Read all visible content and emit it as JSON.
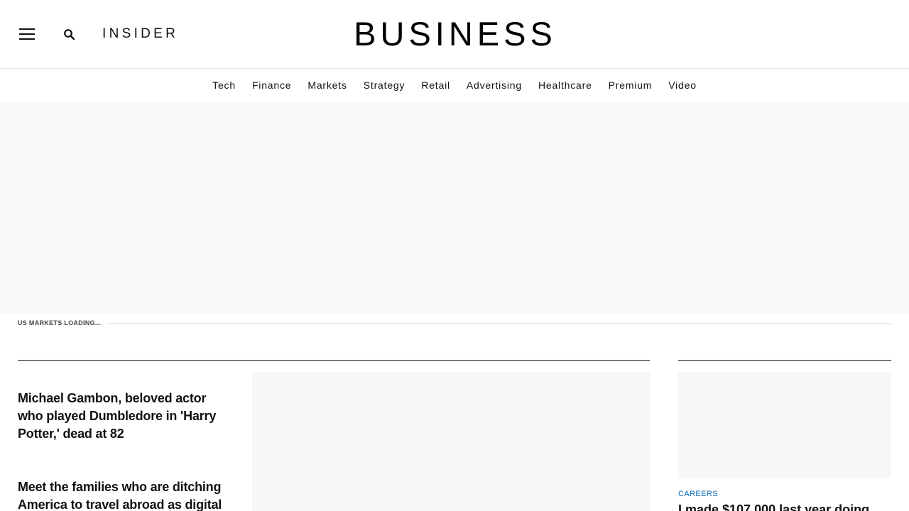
{
  "header": {
    "menu_icon": "hamburger-menu-icon",
    "search_icon": "search-icon",
    "small_logo": "INSIDER",
    "main_logo": "BUSINESS"
  },
  "nav": {
    "items": [
      "Tech",
      "Finance",
      "Markets",
      "Strategy",
      "Retail",
      "Advertising",
      "Healthcare",
      "Premium",
      "Video"
    ]
  },
  "markets": {
    "label": "US MARKETS LOADING..."
  },
  "stories": [
    {
      "headline": "Michael Gambon, beloved actor who played Dumbledore in 'Harry Potter,' dead at 82"
    },
    {
      "headline": "Meet the families who are ditching America to travel abroad as digital"
    }
  ],
  "sidebar_story": {
    "category": "CAREERS",
    "headline": "I made $107,000 last year doing"
  },
  "colors": {
    "accent_link": "#0a6ab8",
    "ad_background": "#f7f9f9",
    "image_placeholder": "#f7f7f7"
  }
}
